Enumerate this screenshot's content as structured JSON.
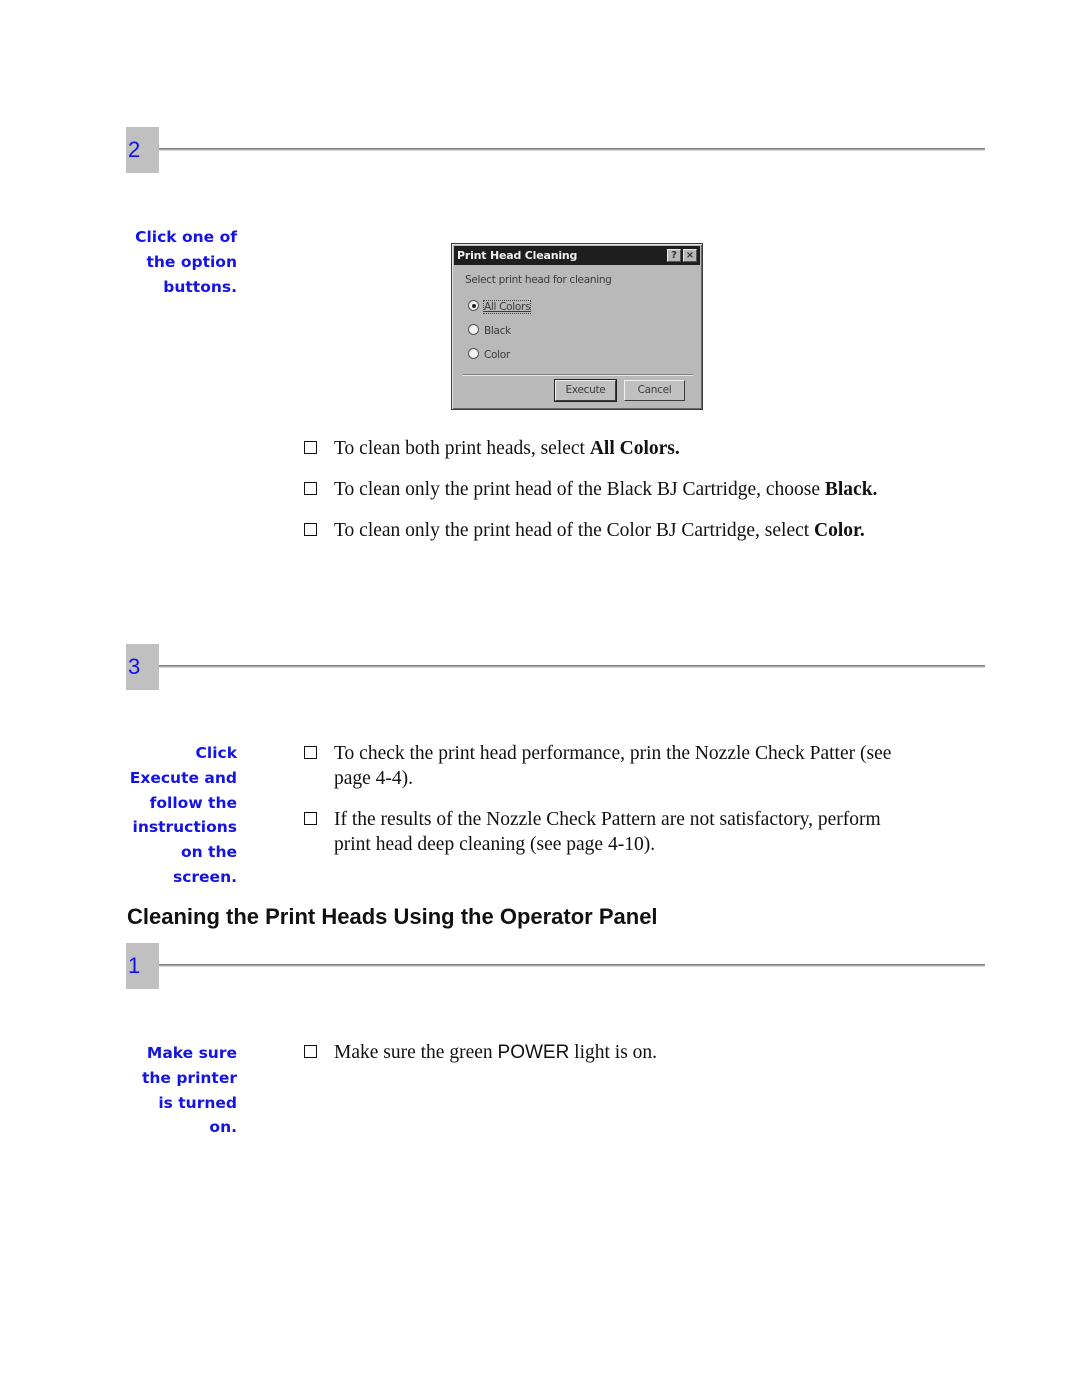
{
  "steps": [
    {
      "number": "2",
      "note_lines": [
        "Click one of",
        "the option",
        "buttons."
      ],
      "dialog": {
        "title": "Print Head Cleaning",
        "help_button": "?",
        "close_button": "×",
        "prompt": "Select print head for cleaning",
        "options": [
          {
            "label": "All Colors",
            "selected": true
          },
          {
            "label": "Black",
            "selected": false
          },
          {
            "label": "Color",
            "selected": false
          }
        ],
        "buttons": {
          "execute": "Execute",
          "cancel": "Cancel"
        }
      },
      "bullets": [
        {
          "text": "To clean both print heads, select ",
          "bold": "All Colors."
        },
        {
          "text": "To clean only the print head of the Black BJ Cartridge, choose ",
          "bold": "Black."
        },
        {
          "text": "To clean only the print head of the Color BJ Cartridge, select ",
          "bold": "Color."
        }
      ]
    },
    {
      "number": "3",
      "note_lines": [
        "Click",
        "Execute and",
        "follow the",
        "instructions",
        "on the",
        "screen."
      ],
      "bullets": [
        {
          "text": "To check the print head performance, prin the Nozzle Check Patter (see page 4-4)."
        },
        {
          "text": "If the results of the Nozzle Check Pattern are not satisfactory, perform print head deep cleaning (see page 4-10)."
        }
      ]
    }
  ],
  "section": {
    "heading": "Cleaning the Print Heads Using the Operator Panel",
    "steps": [
      {
        "number": "1",
        "note_lines": [
          "Make sure",
          "the printer",
          "is turned",
          "on."
        ],
        "bullets": [
          {
            "before": "Make sure the green ",
            "sans": "POWER",
            "after": " light is on."
          }
        ]
      }
    ]
  },
  "colors": {
    "step_number": "#1010ee",
    "step_box": "#c0c0c0",
    "margin_note": "#1414e6",
    "body_text": "#111111"
  }
}
